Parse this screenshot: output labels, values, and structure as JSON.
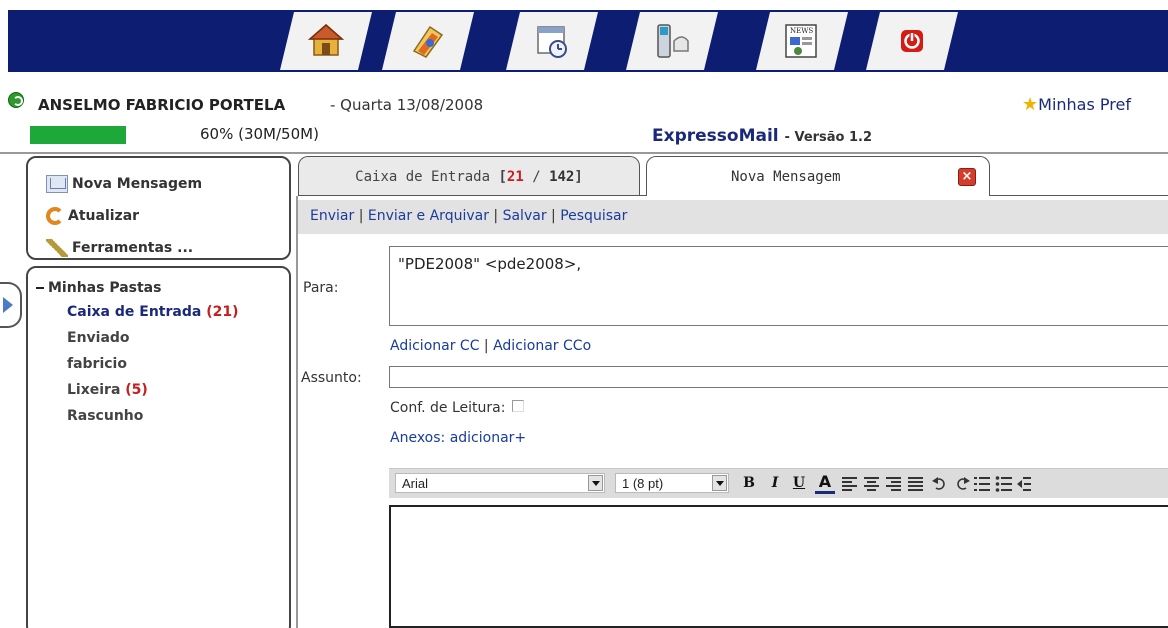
{
  "topbar": {
    "buttons": [
      {
        "name": "home-icon"
      },
      {
        "name": "addressbook-icon"
      },
      {
        "name": "calendar-icon"
      },
      {
        "name": "phone-icon"
      },
      {
        "name": "news-icon"
      },
      {
        "name": "logout-icon"
      }
    ],
    "news_label": "NEWS"
  },
  "user": {
    "name": "ANSELMO FABRICIO PORTELA",
    "date": "- Quarta 13/08/2008",
    "prefs": "Minhas Pref"
  },
  "quota": {
    "percent": 60,
    "text": "60% (30M/50M)"
  },
  "app": {
    "title": "ExpressoMail",
    "version": "- Versão 1.2"
  },
  "actions": {
    "new_message": "Nova Mensagem",
    "refresh": "Atualizar",
    "tools": "Ferramentas ..."
  },
  "folders": {
    "title": "Minhas Pastas",
    "items": [
      {
        "label": "Caixa de Entrada",
        "count": "(21)"
      },
      {
        "label": "Enviado",
        "count": ""
      },
      {
        "label": "fabricio",
        "count": ""
      },
      {
        "label": "Lixeira",
        "count": "(5)"
      },
      {
        "label": "Rascunho",
        "count": ""
      }
    ]
  },
  "tabs": {
    "inbox_label": "Caixa de Entrada",
    "inbox_unread": "21",
    "inbox_sep": "/",
    "inbox_total": "142",
    "new_label": "Nova Mensagem",
    "close": "×"
  },
  "msgbar": {
    "send": "Enviar",
    "send_archive": "Enviar e Arquivar",
    "save": "Salvar",
    "search": "Pesquisar",
    "sep": "|"
  },
  "form": {
    "to_label": "Para:",
    "to_value": "\"PDE2008\" <pde2008>,",
    "add_cc": "Adicionar CC",
    "add_cco": "Adicionar CCo",
    "cc_sep": "|",
    "subject_label": "Assunto:",
    "subject_value": "",
    "read_receipt": "Conf. de Leitura:",
    "attachments": "Anexos: adicionar+"
  },
  "editor": {
    "font": "Arial",
    "size": "1 (8 pt)",
    "bold": "B",
    "italic": "I",
    "underline": "U",
    "color": "A"
  }
}
